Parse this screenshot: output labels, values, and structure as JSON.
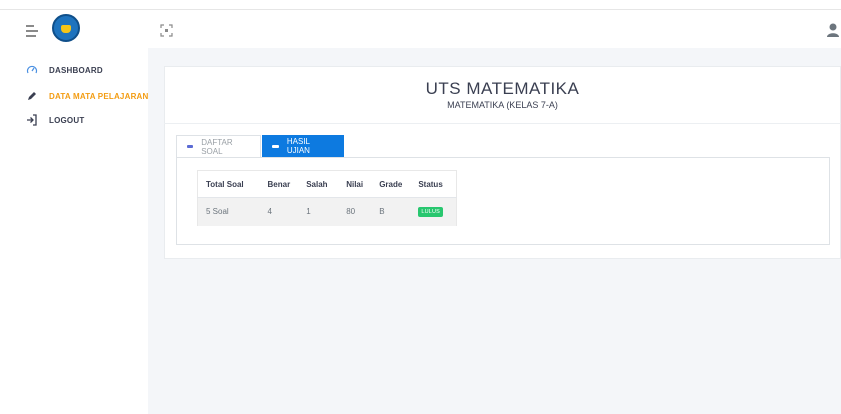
{
  "sidebar": {
    "items": [
      {
        "label": "DASHBOARD",
        "icon": "gauge-icon"
      },
      {
        "label": "DATA MATA PELAJARAN",
        "icon": "pencil-icon"
      },
      {
        "label": "LOGOUT",
        "icon": "logout-icon"
      }
    ]
  },
  "page": {
    "title": "UTS MATEMATIKA",
    "subtitle": "MATEMATIKA (KELAS 7-A)"
  },
  "tabs": [
    {
      "label": "DAFTAR SOAL",
      "active": false
    },
    {
      "label": "HASIL UJIAN",
      "active": true
    }
  ],
  "results": {
    "headers": [
      "Total Soal",
      "Benar",
      "Salah",
      "Nilai",
      "Grade",
      "Status"
    ],
    "row": {
      "total_soal": "5 Soal",
      "benar": "4",
      "salah": "1",
      "nilai": "80",
      "grade": "B",
      "status": "LULUS"
    }
  },
  "colors": {
    "accent": "#0d7ae0",
    "active_nav": "#f39c12",
    "status_badge": "#28c76f"
  }
}
